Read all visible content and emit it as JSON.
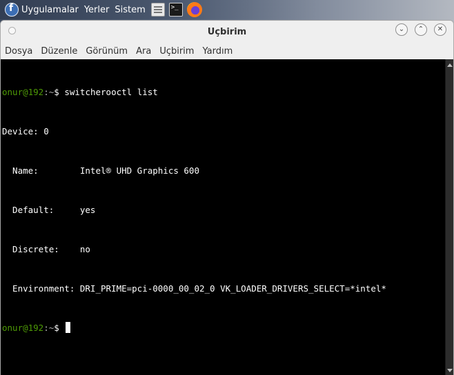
{
  "panel": {
    "menus": [
      "Uygulamalar",
      "Yerler",
      "Sistem"
    ],
    "launchers": [
      "file-manager-icon",
      "terminal-icon",
      "firefox-icon"
    ]
  },
  "window": {
    "title": "Uçbirim",
    "minimize_glyph": "⌄",
    "maximize_glyph": "⌃",
    "close_glyph": "✕"
  },
  "menubar": {
    "items": [
      "Dosya",
      "Düzenle",
      "Görünüm",
      "Ara",
      "Uçbirim",
      "Yardım"
    ]
  },
  "terminal": {
    "prompt_user": "onur@192",
    "prompt_path": ":~",
    "prompt_symbol": "$ ",
    "command": "switcherooctl list",
    "output": [
      "Device: 0",
      "  Name:        Intel® UHD Graphics 600",
      "  Default:     yes",
      "  Discrete:    no",
      "  Environment: DRI_PRIME=pci-0000_00_02_0 VK_LOADER_DRIVERS_SELECT=*intel*"
    ]
  },
  "colors": {
    "prompt": "#4e9a06",
    "terminal_bg": "#000000",
    "terminal_fg": "#ffffff"
  }
}
